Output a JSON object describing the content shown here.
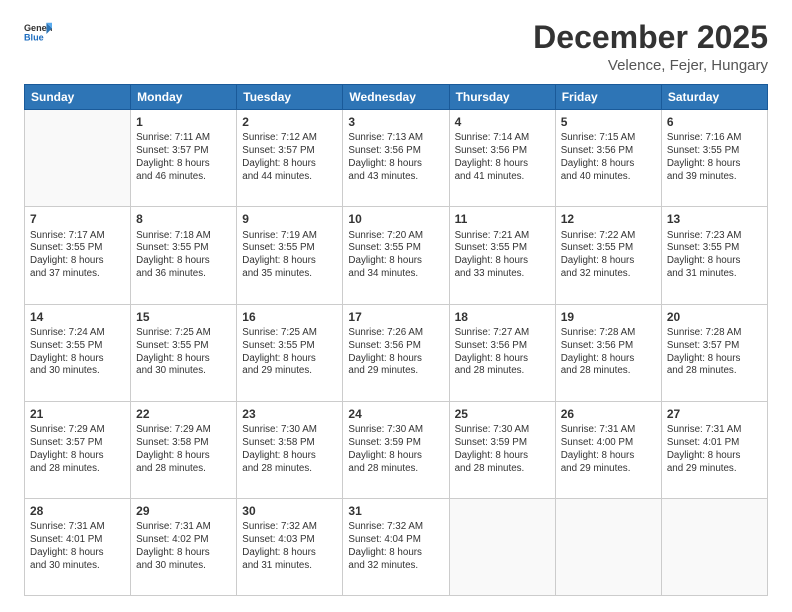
{
  "logo": {
    "general": "General",
    "blue": "Blue"
  },
  "header": {
    "month": "December 2025",
    "location": "Velence, Fejer, Hungary"
  },
  "days_of_week": [
    "Sunday",
    "Monday",
    "Tuesday",
    "Wednesday",
    "Thursday",
    "Friday",
    "Saturday"
  ],
  "weeks": [
    [
      {
        "day": "",
        "info": ""
      },
      {
        "day": "1",
        "info": "Sunrise: 7:11 AM\nSunset: 3:57 PM\nDaylight: 8 hours\nand 46 minutes."
      },
      {
        "day": "2",
        "info": "Sunrise: 7:12 AM\nSunset: 3:57 PM\nDaylight: 8 hours\nand 44 minutes."
      },
      {
        "day": "3",
        "info": "Sunrise: 7:13 AM\nSunset: 3:56 PM\nDaylight: 8 hours\nand 43 minutes."
      },
      {
        "day": "4",
        "info": "Sunrise: 7:14 AM\nSunset: 3:56 PM\nDaylight: 8 hours\nand 41 minutes."
      },
      {
        "day": "5",
        "info": "Sunrise: 7:15 AM\nSunset: 3:56 PM\nDaylight: 8 hours\nand 40 minutes."
      },
      {
        "day": "6",
        "info": "Sunrise: 7:16 AM\nSunset: 3:55 PM\nDaylight: 8 hours\nand 39 minutes."
      }
    ],
    [
      {
        "day": "7",
        "info": "Sunrise: 7:17 AM\nSunset: 3:55 PM\nDaylight: 8 hours\nand 37 minutes."
      },
      {
        "day": "8",
        "info": "Sunrise: 7:18 AM\nSunset: 3:55 PM\nDaylight: 8 hours\nand 36 minutes."
      },
      {
        "day": "9",
        "info": "Sunrise: 7:19 AM\nSunset: 3:55 PM\nDaylight: 8 hours\nand 35 minutes."
      },
      {
        "day": "10",
        "info": "Sunrise: 7:20 AM\nSunset: 3:55 PM\nDaylight: 8 hours\nand 34 minutes."
      },
      {
        "day": "11",
        "info": "Sunrise: 7:21 AM\nSunset: 3:55 PM\nDaylight: 8 hours\nand 33 minutes."
      },
      {
        "day": "12",
        "info": "Sunrise: 7:22 AM\nSunset: 3:55 PM\nDaylight: 8 hours\nand 32 minutes."
      },
      {
        "day": "13",
        "info": "Sunrise: 7:23 AM\nSunset: 3:55 PM\nDaylight: 8 hours\nand 31 minutes."
      }
    ],
    [
      {
        "day": "14",
        "info": "Sunrise: 7:24 AM\nSunset: 3:55 PM\nDaylight: 8 hours\nand 30 minutes."
      },
      {
        "day": "15",
        "info": "Sunrise: 7:25 AM\nSunset: 3:55 PM\nDaylight: 8 hours\nand 30 minutes."
      },
      {
        "day": "16",
        "info": "Sunrise: 7:25 AM\nSunset: 3:55 PM\nDaylight: 8 hours\nand 29 minutes."
      },
      {
        "day": "17",
        "info": "Sunrise: 7:26 AM\nSunset: 3:56 PM\nDaylight: 8 hours\nand 29 minutes."
      },
      {
        "day": "18",
        "info": "Sunrise: 7:27 AM\nSunset: 3:56 PM\nDaylight: 8 hours\nand 28 minutes."
      },
      {
        "day": "19",
        "info": "Sunrise: 7:28 AM\nSunset: 3:56 PM\nDaylight: 8 hours\nand 28 minutes."
      },
      {
        "day": "20",
        "info": "Sunrise: 7:28 AM\nSunset: 3:57 PM\nDaylight: 8 hours\nand 28 minutes."
      }
    ],
    [
      {
        "day": "21",
        "info": "Sunrise: 7:29 AM\nSunset: 3:57 PM\nDaylight: 8 hours\nand 28 minutes."
      },
      {
        "day": "22",
        "info": "Sunrise: 7:29 AM\nSunset: 3:58 PM\nDaylight: 8 hours\nand 28 minutes."
      },
      {
        "day": "23",
        "info": "Sunrise: 7:30 AM\nSunset: 3:58 PM\nDaylight: 8 hours\nand 28 minutes."
      },
      {
        "day": "24",
        "info": "Sunrise: 7:30 AM\nSunset: 3:59 PM\nDaylight: 8 hours\nand 28 minutes."
      },
      {
        "day": "25",
        "info": "Sunrise: 7:30 AM\nSunset: 3:59 PM\nDaylight: 8 hours\nand 28 minutes."
      },
      {
        "day": "26",
        "info": "Sunrise: 7:31 AM\nSunset: 4:00 PM\nDaylight: 8 hours\nand 29 minutes."
      },
      {
        "day": "27",
        "info": "Sunrise: 7:31 AM\nSunset: 4:01 PM\nDaylight: 8 hours\nand 29 minutes."
      }
    ],
    [
      {
        "day": "28",
        "info": "Sunrise: 7:31 AM\nSunset: 4:01 PM\nDaylight: 8 hours\nand 30 minutes."
      },
      {
        "day": "29",
        "info": "Sunrise: 7:31 AM\nSunset: 4:02 PM\nDaylight: 8 hours\nand 30 minutes."
      },
      {
        "day": "30",
        "info": "Sunrise: 7:32 AM\nSunset: 4:03 PM\nDaylight: 8 hours\nand 31 minutes."
      },
      {
        "day": "31",
        "info": "Sunrise: 7:32 AM\nSunset: 4:04 PM\nDaylight: 8 hours\nand 32 minutes."
      },
      {
        "day": "",
        "info": ""
      },
      {
        "day": "",
        "info": ""
      },
      {
        "day": "",
        "info": ""
      }
    ]
  ]
}
